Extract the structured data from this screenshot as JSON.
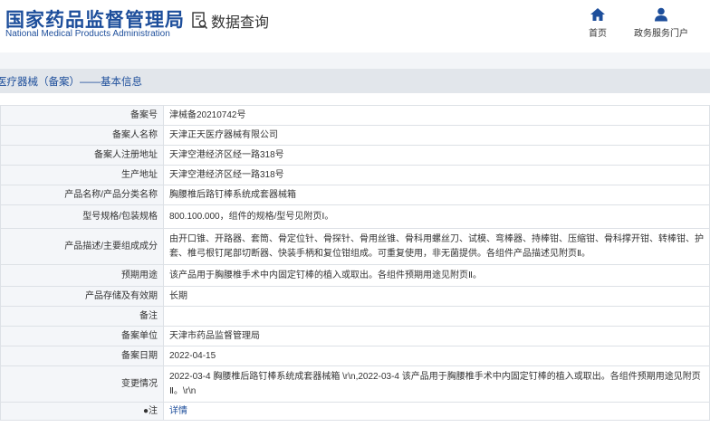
{
  "header": {
    "logo_cn": "国家药品监督管理局",
    "logo_en": "National Medical Products Administration",
    "query_label": "数据查询",
    "query_icon": "document-search-icon",
    "nav": [
      {
        "label": "首页",
        "icon": "home-icon"
      },
      {
        "label": "政务服务门户",
        "icon": "user-icon"
      }
    ]
  },
  "breadcrumb": "医疗器械（备案）——基本信息",
  "colors": {
    "brand": "#1d4e9b",
    "label_bg": "#f4f6f9",
    "border": "#dde1e6",
    "crumb_bg": "#e2e6eb"
  },
  "rows": [
    {
      "label": "备案号",
      "value": "津械备20210742号"
    },
    {
      "label": "备案人名称",
      "value": "天津正天医疗器械有限公司"
    },
    {
      "label": "备案人注册地址",
      "value": "天津空港经济区经一路318号"
    },
    {
      "label": "生产地址",
      "value": "天津空港经济区经一路318号"
    },
    {
      "label": "产品名称/产品分类名称",
      "value": "胸腰椎后路钉棒系统成套器械箱"
    },
    {
      "label": "型号规格/包装规格",
      "value": "800.100.000，组件的规格/型号见附页Ⅰ。"
    },
    {
      "label": "产品描述/主要组成成分",
      "value": "由开口锥、开路器、套筒、骨定位针、骨探针、骨用丝锥、骨科用螺丝刀、试模、弯棒器、持棒钳、压缩钳、骨科撑开钳、转棒钳、护套、椎弓根钉尾部切断器、快装手柄和复位钳组成。可重复使用，非无菌提供。各组件产品描述见附页Ⅱ。"
    },
    {
      "label": "预期用途",
      "value": "该产品用于胸腰椎手术中内固定钉棒的植入或取出。各组件预期用途见附页Ⅱ。"
    },
    {
      "label": "产品存储及有效期",
      "value": "长期"
    },
    {
      "label": "备注",
      "value": ""
    },
    {
      "label": "备案单位",
      "value": "天津市药品监督管理局"
    },
    {
      "label": "备案日期",
      "value": "2022-04-15"
    },
    {
      "label": "变更情况",
      "value": "2022-03-4 胸腰椎后路钉棒系统成套器械箱 \\r\\n,2022-03-4 该产品用于胸腰椎手术中内固定钉棒的植入或取出。各组件预期用途见附页Ⅱ。\\r\\n"
    },
    {
      "label": "注",
      "value": "详情",
      "icon": "pin-icon"
    }
  ]
}
